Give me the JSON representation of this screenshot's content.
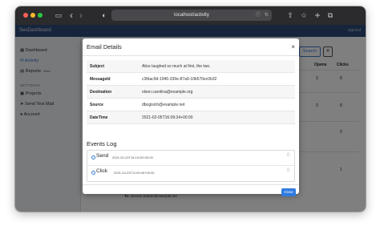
{
  "browser": {
    "url": "localhost/activity",
    "nav_back": "‹",
    "nav_forward": "›",
    "sidebar_toggle": "▭",
    "shield": "◐",
    "reader": "ⓡ",
    "reload": "↻",
    "share": "⇧",
    "bookmark": "☆",
    "new_tab": "+",
    "tabs": "⧉"
  },
  "app": {
    "brand": "SesDashboard",
    "nav_right": "signout"
  },
  "sidebar": {
    "items": [
      {
        "label": "Dashboard",
        "icon": "▦"
      },
      {
        "label": "Activity",
        "icon": "✉"
      },
      {
        "label": "Reports",
        "icon": "▤",
        "badge": "Beta"
      }
    ],
    "heading": "SETTINGS",
    "settings": [
      {
        "label": "Projects",
        "icon": "▣"
      },
      {
        "label": "Send Test Mail",
        "icon": "➤"
      },
      {
        "label": "Account",
        "icon": "●"
      }
    ]
  },
  "background": {
    "search_label": "Search",
    "clear_label": "✕",
    "col_opens": "Opens",
    "col_clicks": "Clicks",
    "rows": [
      {
        "opens": "3",
        "clicks": "8"
      },
      {
        "opens": "0",
        "clicks": "8"
      },
      {
        "opens": "",
        "clicks": "5"
      },
      {
        "opens": "",
        "clicks": "1"
      }
    ],
    "to_label": "To:",
    "to_value": "simone.harber@example.net"
  },
  "modal": {
    "title": "Email Details",
    "close_icon": "×",
    "details": [
      {
        "key": "Subject",
        "value": "Alice laughed so much at first, the two."
      },
      {
        "key": "MessageId",
        "value": "c3fdac9d-1946-339e-87a9-10b570ec0b32"
      },
      {
        "key": "Destination",
        "value": "olson.carolina@example.org"
      },
      {
        "key": "Source",
        "value": "dbogisich@example.net"
      },
      {
        "key": "DateTime",
        "value": "2021-02-05T16:09:34+00:00"
      }
    ],
    "events_title": "Events Log",
    "events": [
      {
        "name": "Send",
        "time": "2021-02-23T16:19:25+00:00"
      },
      {
        "name": "Click",
        "time": "2021-02-23T11:09:49+00:00"
      }
    ],
    "close_button": "Close"
  }
}
